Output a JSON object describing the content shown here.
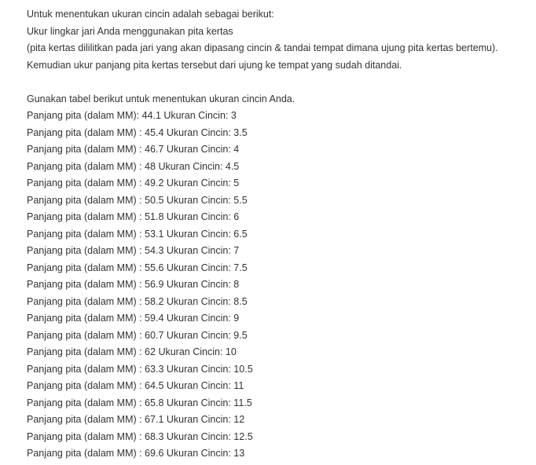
{
  "intro": {
    "line1": "Untuk menentukan ukuran cincin adalah sebagai berikut:",
    "line2": "Ukur lingkar jari Anda menggunakan pita kertas",
    "line3": "(pita kertas dililitkan pada jari yang akan dipasang cincin & tandai tempat dimana ujung pita kertas bertemu).",
    "line4": "Kemudian ukur panjang pita kertas tersebut dari ujung ke tempat yang sudah ditandai."
  },
  "table_intro": "Gunakan tabel berikut untuk menentukan ukuran cincin Anda.",
  "sizes": [
    "Panjang pita (dalam MM): 44.1 Ukuran Cincin: 3",
    "Panjang pita (dalam MM) : 45.4 Ukuran Cincin: 3.5",
    "Panjang pita (dalam MM) : 46.7 Ukuran Cincin: 4",
    "Panjang pita (dalam MM) : 48 Ukuran Cincin: 4.5",
    "Panjang pita (dalam MM) : 49.2 Ukuran Cincin: 5",
    "Panjang pita (dalam MM) : 50.5 Ukuran Cincin: 5.5",
    "Panjang pita (dalam MM) : 51.8 Ukuran Cincin: 6",
    "Panjang pita (dalam MM) : 53.1 Ukuran Cincin: 6.5",
    "Panjang pita (dalam MM) : 54.3 Ukuran Cincin: 7",
    "Panjang pita (dalam MM) : 55.6 Ukuran Cincin: 7.5",
    "Panjang pita (dalam MM) : 56.9 Ukuran Cincin: 8",
    "Panjang pita (dalam MM) : 58.2 Ukuran Cincin: 8.5",
    "Panjang pita (dalam MM) : 59.4 Ukuran Cincin: 9",
    "Panjang pita (dalam MM) : 60.7 Ukuran Cincin: 9.5",
    "Panjang pita (dalam MM) : 62 Ukuran Cincin: 10",
    "Panjang pita (dalam MM) : 63.3 Ukuran Cincin: 10.5",
    "Panjang pita (dalam MM) : 64.5 Ukuran Cincin: 11",
    "Panjang pita (dalam MM) : 65.8 Ukuran Cincin: 11.5",
    "Panjang pita (dalam MM) : 67.1 Ukuran Cincin: 12",
    "Panjang pita (dalam MM) : 68.3 Ukuran Cincin: 12.5",
    "Panjang pita (dalam MM) : 69.6 Ukuran Cincin: 13"
  ]
}
